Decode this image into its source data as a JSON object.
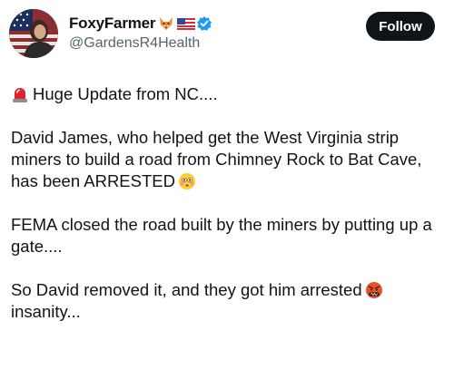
{
  "author": {
    "display_name": "FoxyFarmer",
    "handle": "@GardensR4Health",
    "name_icons": [
      "fox-emoji",
      "us-flag-emoji",
      "verified-badge"
    ]
  },
  "follow_label": "Follow",
  "post": {
    "headline": "Huge Update from NC....",
    "paragraphs": {
      "p1": "David James, who helped get the West Virginia strip miners to build a road from Chimney Rock to Bat Cave, has been ARRESTED",
      "p2": "FEMA closed the road built by the miners by putting up a gate....",
      "p3": "So David removed it, and they got him arrested",
      "p3_end": "insanity..."
    },
    "emojis": [
      "siren-emoji",
      "flushed-face-emoji",
      "cursing-face-emoji"
    ]
  },
  "colors": {
    "text": "#0f1419",
    "secondary_text": "#536471",
    "follow_bg": "#0f1419",
    "verified": "#1d9bf0"
  }
}
